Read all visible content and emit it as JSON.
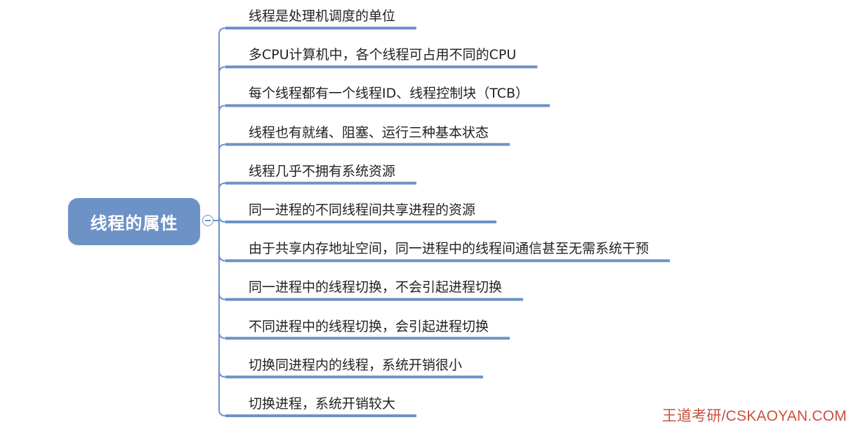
{
  "root": {
    "label": "线程的属性",
    "toggle_state": "expanded",
    "color": "#6d92c6"
  },
  "branches": [
    {
      "label": "线程是处理机调度的单位"
    },
    {
      "label": "多CPU计算机中，各个线程可占用不同的CPU"
    },
    {
      "label": "每个线程都有一个线程ID、线程控制块（TCB）"
    },
    {
      "label": "线程也有就绪、阻塞、运行三种基本状态"
    },
    {
      "label": "线程几乎不拥有系统资源"
    },
    {
      "label": "同一进程的不同线程间共享进程的资源"
    },
    {
      "label": "由于共享内存地址空间，同一进程中的线程间通信甚至无需系统干预"
    },
    {
      "label": "同一进程中的线程切换，不会引起进程切换"
    },
    {
      "label": "不同进程中的线程切换，会引起进程切换"
    },
    {
      "label": "切换同进程内的线程，系统开销很小"
    },
    {
      "label": "切换进程，系统开销较大"
    }
  ],
  "watermark": "王道考研/CSKAOYAN.COM",
  "colors": {
    "connector": "#6d92c6",
    "watermark": "#c8503e",
    "text": "#222222"
  }
}
